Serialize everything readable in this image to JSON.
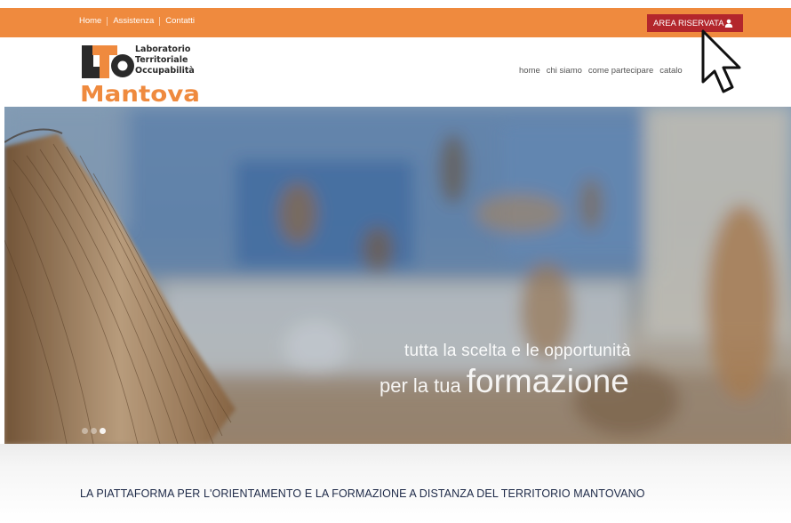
{
  "topbar": {
    "links": [
      "Home",
      "Assistenza",
      "Contatti"
    ],
    "area_button": "AREA RISERVATA",
    "area_icon": "user-icon",
    "color": "#ef8a3e",
    "button_color": "#b3262c"
  },
  "logo": {
    "letters": "LTO",
    "line1": "Laboratorio",
    "line2": "Territoriale",
    "line3": "Occupabilità",
    "city": "Mantova",
    "color_orange": "#ef8a3e",
    "color_dark": "#2a2a2a"
  },
  "nav": {
    "items": [
      "home",
      "chi siamo",
      "come partecipare",
      "catalo"
    ]
  },
  "hero": {
    "line1": "tutta la scelta e le opportunità",
    "line2_small": "per la tua",
    "line2_big": "formazione",
    "slides": 3,
    "active_slide": 3
  },
  "tagline": "LA PIATTAFORMA PER L'ORIENTAMENTO E LA FORMAZIONE A DISTANZA DEL TERRITORIO MANTOVANO"
}
